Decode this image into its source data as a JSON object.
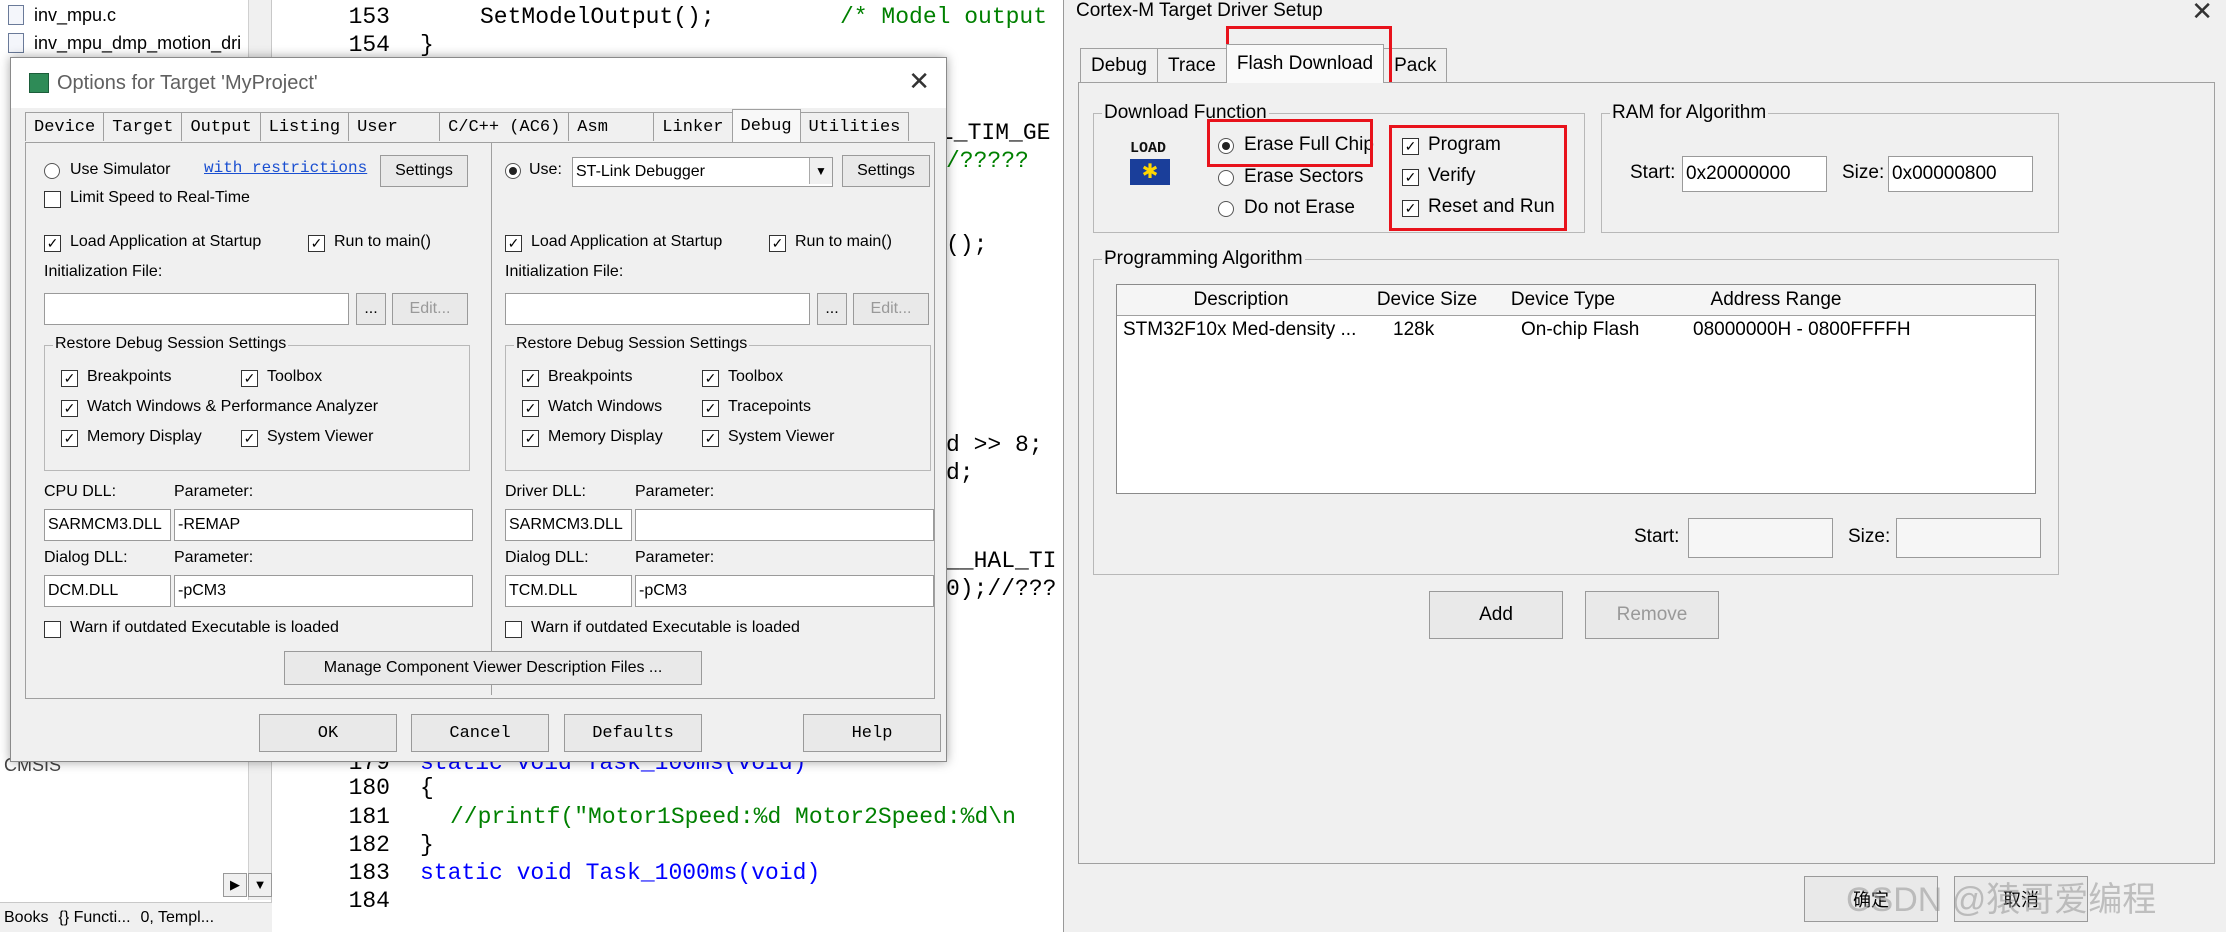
{
  "ide": {
    "files": [
      "inv_mpu.c",
      "inv_mpu_dmp_motion_dri"
    ],
    "cmsis_label": "CMSIS",
    "bottom_tabs": [
      "Books",
      "{} Functi...",
      "0, Templ..."
    ],
    "line_numbers_top": [
      "153",
      "154"
    ],
    "line_numbers_bottom": [
      "179",
      "180",
      "181",
      "182",
      "183",
      "184"
    ],
    "code_top": [
      "SetModelOutput();",
      "/* Model output"
    ],
    "code_top_brace": "}",
    "code_mid": [
      "L_TIM_GE",
      "/?????",
      "();",
      "d >> 8;",
      "d;",
      "__HAL_TI",
      "0);//???"
    ],
    "code_bottom": [
      "static void Task_100ms(void)",
      "{",
      "//printf(\"Motor1Speed:%d Motor2Speed:%d\\n",
      "}",
      "static void Task_1000ms(void)"
    ]
  },
  "options_dialog": {
    "title": "Options for Target 'MyProject'",
    "tabs": [
      "Device",
      "Target",
      "Output",
      "Listing",
      "User",
      "C/C++ (AC6)",
      "Asm",
      "Linker",
      "Debug",
      "Utilities"
    ],
    "active_tab": "Debug",
    "left": {
      "use_simulator": "Use Simulator",
      "with_restrictions": "with restrictions",
      "settings": "Settings",
      "limit_speed": "Limit Speed to Real-Time",
      "load_app": "Load Application at Startup",
      "run_to_main": "Run to main()",
      "init_file": "Initialization File:",
      "browse": "...",
      "edit": "Edit...",
      "restore_group": "Restore Debug Session Settings",
      "breakpoints": "Breakpoints",
      "toolbox": "Toolbox",
      "watch": "Watch Windows & Performance Analyzer",
      "memory": "Memory Display",
      "system_viewer": "System Viewer",
      "cpu_dll_label": "CPU DLL:",
      "parameter": "Parameter:",
      "cpu_dll": "SARMCM3.DLL",
      "cpu_param": "-REMAP",
      "dialog_dll_label": "Dialog DLL:",
      "dialog_dll": "DCM.DLL",
      "dialog_param": "-pCM3",
      "warn": "Warn if outdated Executable is loaded"
    },
    "right": {
      "use": "Use:",
      "debugger": "ST-Link Debugger",
      "settings": "Settings",
      "load_app": "Load Application at Startup",
      "run_to_main": "Run to main()",
      "init_file": "Initialization File:",
      "browse": "...",
      "edit": "Edit...",
      "restore_group": "Restore Debug Session Settings",
      "breakpoints": "Breakpoints",
      "toolbox": "Toolbox",
      "watch": "Watch Windows",
      "tracepoints": "Tracepoints",
      "memory": "Memory Display",
      "system_viewer": "System Viewer",
      "driver_dll_label": "Driver DLL:",
      "parameter": "Parameter:",
      "driver_dll": "SARMCM3.DLL",
      "driver_param": "",
      "dialog_dll_label": "Dialog DLL:",
      "dialog_dll": "TCM.DLL",
      "dialog_param": "-pCM3",
      "warn": "Warn if outdated Executable is loaded"
    },
    "manage_btn": "Manage Component Viewer Description Files ...",
    "buttons": {
      "ok": "OK",
      "cancel": "Cancel",
      "defaults": "Defaults",
      "help": "Help"
    }
  },
  "cortex_dialog": {
    "title": "Cortex-M Target Driver Setup",
    "tabs": [
      "Debug",
      "Trace",
      "Flash Download",
      "Pack"
    ],
    "active_tab": "Flash Download",
    "download_group": "Download Function",
    "load_icon_text": "LOAD",
    "erase_full": "Erase Full Chip",
    "erase_sectors": "Erase Sectors",
    "do_not_erase": "Do not Erase",
    "program": "Program",
    "verify": "Verify",
    "reset_run": "Reset and Run",
    "ram_group": "RAM for Algorithm",
    "start_label": "Start:",
    "start_value": "0x20000000",
    "size_label": "Size:",
    "size_value": "0x00000800",
    "prog_group": "Programming Algorithm",
    "columns": [
      "Description",
      "Device Size",
      "Device Type",
      "Address Range"
    ],
    "rows": [
      [
        "STM32F10x Med-density ...",
        "128k",
        "On-chip Flash",
        "08000000H - 0800FFFFH"
      ]
    ],
    "algo_start_label": "Start:",
    "algo_size_label": "Size:",
    "add": "Add",
    "remove": "Remove",
    "ok": "确定",
    "cancel": "取消",
    "watermark": "CSDN @猿哥爱编程",
    "highlight_color": "#e8121b"
  }
}
